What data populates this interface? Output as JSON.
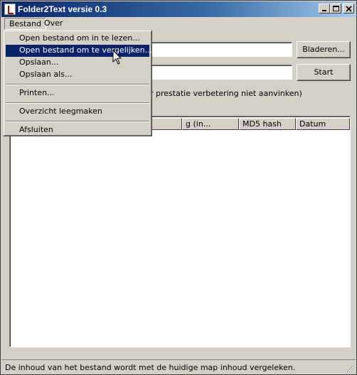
{
  "window": {
    "title": "Folder2Text versie 0.3"
  },
  "menubar": {
    "items": [
      {
        "label": "Bestand"
      },
      {
        "label": "Over"
      }
    ]
  },
  "dropdown": {
    "items": [
      {
        "label": "Open bestand om in te lezen..."
      },
      {
        "label": "Open bestand om te vergelijken..."
      },
      {
        "label": "Opslaan..."
      },
      {
        "label": "Opslaan als..."
      },
      {
        "label": "Printen..."
      },
      {
        "label": "Overzicht leegmaken"
      },
      {
        "label": "Afsluiten"
      }
    ]
  },
  "buttons": {
    "bladeren": "Bladeren...",
    "start": "Start"
  },
  "checkbox": {
    "label": "r prestatie verbetering niet aanvinken)"
  },
  "list": {
    "columns": [
      "",
      "g (in...",
      "MD5 hash",
      "Datum"
    ]
  },
  "status": {
    "text": "De inhoud van het bestand wordt met de huidige map inhoud vergeleken."
  }
}
